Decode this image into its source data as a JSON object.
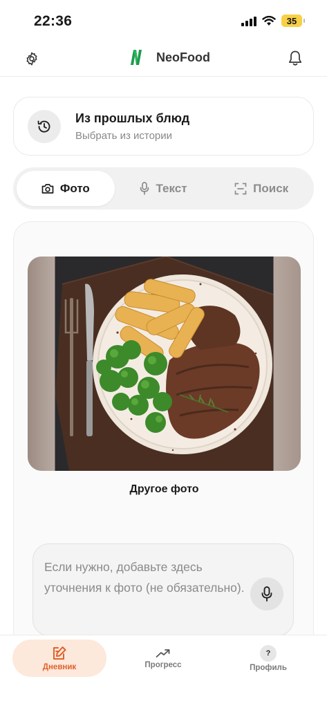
{
  "status_bar": {
    "time": "22:36",
    "battery": "35"
  },
  "header": {
    "brand": "NeoFood"
  },
  "history": {
    "title": "Из прошлых блюд",
    "subtitle": "Выбрать из истории"
  },
  "tabs": [
    {
      "label": "Фото",
      "icon": "camera-icon",
      "active": true
    },
    {
      "label": "Текст",
      "icon": "microphone-icon",
      "active": false
    },
    {
      "label": "Поиск",
      "icon": "scan-icon",
      "active": false
    }
  ],
  "photo": {
    "retake_label": "Другое фото"
  },
  "note": {
    "placeholder": "Если нужно, добавьте здесь уточнения к фото (не обязательно)."
  },
  "bottom_nav": [
    {
      "label": "Дневник",
      "icon": "diary-icon",
      "active": true
    },
    {
      "label": "Прогресс",
      "icon": "trend-icon",
      "active": false
    },
    {
      "label": "Профиль",
      "icon": "profile-icon",
      "badge": "?",
      "active": false
    }
  ],
  "colors": {
    "accent": "#e0622a",
    "accent_bg": "#fde8dc",
    "brand_green": "#1f9a4c",
    "battery": "#f7d046"
  }
}
